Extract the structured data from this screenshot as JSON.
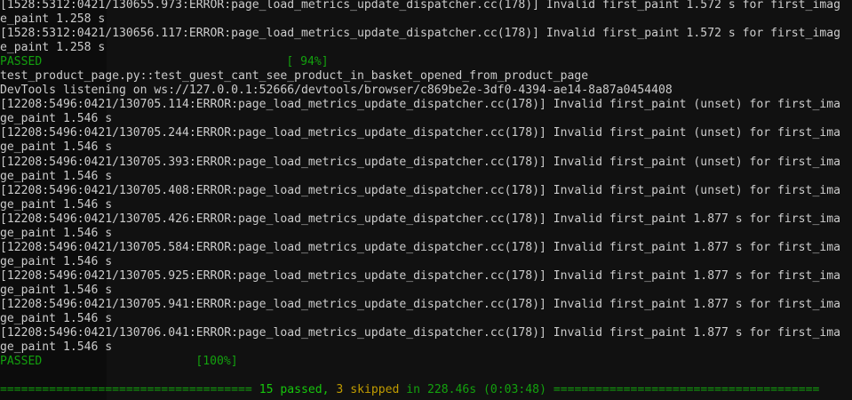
{
  "terminal": {
    "colors": {
      "background": "#0c0c0c",
      "text": "#cccccc",
      "passed": "#13a10e",
      "skipped": "#c19c00"
    },
    "lines": [
      {
        "text": "[1528:5312:0421/130655.973:ERROR:page_load_metrics_update_dispatcher.cc(178)] Invalid first_paint 1.572 s for first_imag",
        "style": "normal"
      },
      {
        "text": "e_paint 1.258 s",
        "style": "normal"
      },
      {
        "text": "[1528:5312:0421/130656.117:ERROR:page_load_metrics_update_dispatcher.cc(178)] Invalid first_paint 1.572 s for first_imag",
        "style": "normal"
      },
      {
        "text": "e_paint 1.258 s",
        "style": "normal"
      },
      {
        "text": "PASSED",
        "style": "passed",
        "progress": "[ 94%]"
      },
      {
        "text": "test_product_page.py::test_guest_cant_see_product_in_basket_opened_from_product_page",
        "style": "normal"
      },
      {
        "text": "DevTools listening on ws://127.0.0.1:52666/devtools/browser/c869be2e-3df0-4394-ae14-8a87a0454408",
        "style": "normal"
      },
      {
        "text": "[12208:5496:0421/130705.114:ERROR:page_load_metrics_update_dispatcher.cc(178)] Invalid first_paint (unset) for first_ima",
        "style": "normal"
      },
      {
        "text": "ge_paint 1.546 s",
        "style": "normal"
      },
      {
        "text": "[12208:5496:0421/130705.244:ERROR:page_load_metrics_update_dispatcher.cc(178)] Invalid first_paint (unset) for first_ima",
        "style": "normal"
      },
      {
        "text": "ge_paint 1.546 s",
        "style": "normal"
      },
      {
        "text": "[12208:5496:0421/130705.393:ERROR:page_load_metrics_update_dispatcher.cc(178)] Invalid first_paint (unset) for first_ima",
        "style": "normal"
      },
      {
        "text": "ge_paint 1.546 s",
        "style": "normal"
      },
      {
        "text": "[12208:5496:0421/130705.408:ERROR:page_load_metrics_update_dispatcher.cc(178)] Invalid first_paint (unset) for first_ima",
        "style": "normal"
      },
      {
        "text": "ge_paint 1.546 s",
        "style": "normal"
      },
      {
        "text": "[12208:5496:0421/130705.426:ERROR:page_load_metrics_update_dispatcher.cc(178)] Invalid first_paint 1.877 s for first_ima",
        "style": "normal"
      },
      {
        "text": "ge_paint 1.546 s",
        "style": "normal"
      },
      {
        "text": "[12208:5496:0421/130705.584:ERROR:page_load_metrics_update_dispatcher.cc(178)] Invalid first_paint 1.877 s for first_ima",
        "style": "normal"
      },
      {
        "text": "ge_paint 1.546 s",
        "style": "normal"
      },
      {
        "text": "[12208:5496:0421/130705.925:ERROR:page_load_metrics_update_dispatcher.cc(178)] Invalid first_paint 1.877 s for first_ima",
        "style": "normal"
      },
      {
        "text": "ge_paint 1.546 s",
        "style": "normal"
      },
      {
        "text": "[12208:5496:0421/130705.941:ERROR:page_load_metrics_update_dispatcher.cc(178)] Invalid first_paint 1.877 s for first_ima",
        "style": "normal"
      },
      {
        "text": "ge_paint 1.546 s",
        "style": "normal"
      },
      {
        "text": "[12208:5496:0421/130706.041:ERROR:page_load_metrics_update_dispatcher.cc(178)] Invalid first_paint 1.877 s for first_ima",
        "style": "normal"
      },
      {
        "text": "ge_paint 1.546 s",
        "style": "normal"
      },
      {
        "text": "PASSED",
        "style": "passed",
        "progress": "[100%]"
      },
      {
        "text": "",
        "style": "normal"
      }
    ],
    "summary": {
      "left_rule": "====================================",
      "passed": "15 passed,",
      "skipped": "3 skipped",
      "in": "in",
      "time": "228.46s (0:03:48)",
      "right_rule": "======================================"
    }
  }
}
